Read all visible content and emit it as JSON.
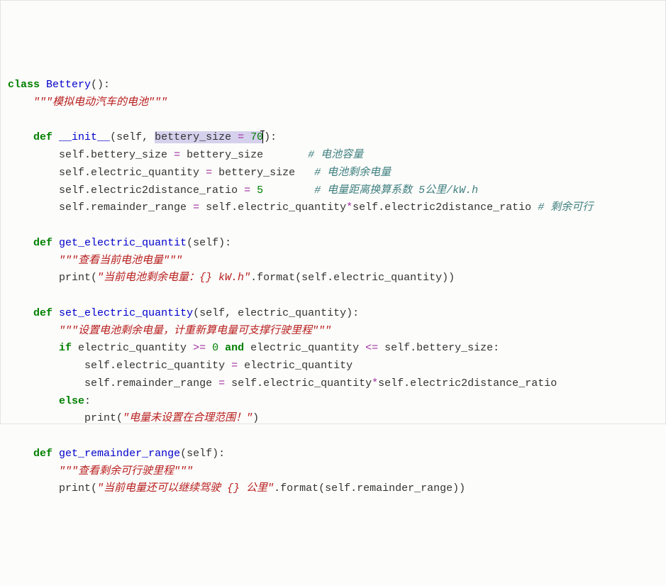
{
  "code": {
    "line01_kw_class": "class",
    "line01_classname": "Bettery",
    "line01_paren": "():",
    "line02_docstring": "\"\"\"模拟电动汽车的电池\"\"\"",
    "line04_def": "def",
    "line04_func": "__init__",
    "line04_open": "(self, ",
    "line04_param_highlight": "bettery_size ",
    "line04_eq": "=",
    "line04_num": " 70",
    "line04_close": "):",
    "line05_self": "self",
    "line05_rest1": ".bettery_size ",
    "line05_eq": "=",
    "line05_rest2": " bettery_size       ",
    "line05_comment": "# 电池容量",
    "line06_self": "self",
    "line06_rest1": ".electric_quantity ",
    "line06_eq": "=",
    "line06_rest2": " bettery_size   ",
    "line06_comment": "# 电池剩余电量",
    "line07_self": "self",
    "line07_rest1": ".electric2distance_ratio ",
    "line07_eq": "=",
    "line07_num": " 5",
    "line07_pad": "        ",
    "line07_comment": "# 电量距离换算系数 5公里/kW.h",
    "line08_self1": "self",
    "line08_p1": ".remainder_range ",
    "line08_eq": "=",
    "line08_p2": " self.electric_quantity",
    "line08_op": "*",
    "line08_p3": "self.electric2distance_ratio ",
    "line08_comment": "# 剩余可行",
    "line10_def": "def",
    "line10_func": "get_electric_quantit",
    "line10_close": "(self):",
    "line11_docstring": "\"\"\"查看当前电池电量\"\"\"",
    "line12_print": "print",
    "line12_open": "(",
    "line12_str": "\"当前电池剩余电量：{} kW.h\"",
    "line12_fmt": ".format(self.electric_quantity))",
    "line14_def": "def",
    "line14_func": "set_electric_quantity",
    "line14_close": "(self, electric_quantity):",
    "line15_docstring": "\"\"\"设置电池剩余电量，计重新算电量可支撑行驶里程\"\"\"",
    "line16_if": "if",
    "line16_p1": " electric_quantity ",
    "line16_op1": ">=",
    "line16_num1": " 0",
    "line16_and": " and ",
    "line16_p2": "electric_quantity ",
    "line16_op2": "<=",
    "line16_p3": " self.bettery_size:",
    "line17_self": "self",
    "line17_p1": ".electric_quantity ",
    "line17_eq": "=",
    "line17_p2": " electric_quantity",
    "line18_self": "self",
    "line18_p1": ".remainder_range ",
    "line18_eq": "=",
    "line18_p2": " self.electric_quantity",
    "line18_op": "*",
    "line18_p3": "self.electric2distance_ratio",
    "line19_else": "else",
    "line19_colon": ":",
    "line20_print": "print",
    "line20_open": "(",
    "line20_str": "\"电量未设置在合理范围！\"",
    "line20_close": ")",
    "line22_def": "def",
    "line22_func": "get_remainder_range",
    "line22_close": "(self):",
    "line23_docstring": "\"\"\"查看剩余可行驶里程\"\"\"",
    "line24_print": "print",
    "line24_open": "(",
    "line24_str": "\"当前电量还可以继续驾驶 {} 公里\"",
    "line24_fmt": ".format(self.remainder_range))"
  }
}
